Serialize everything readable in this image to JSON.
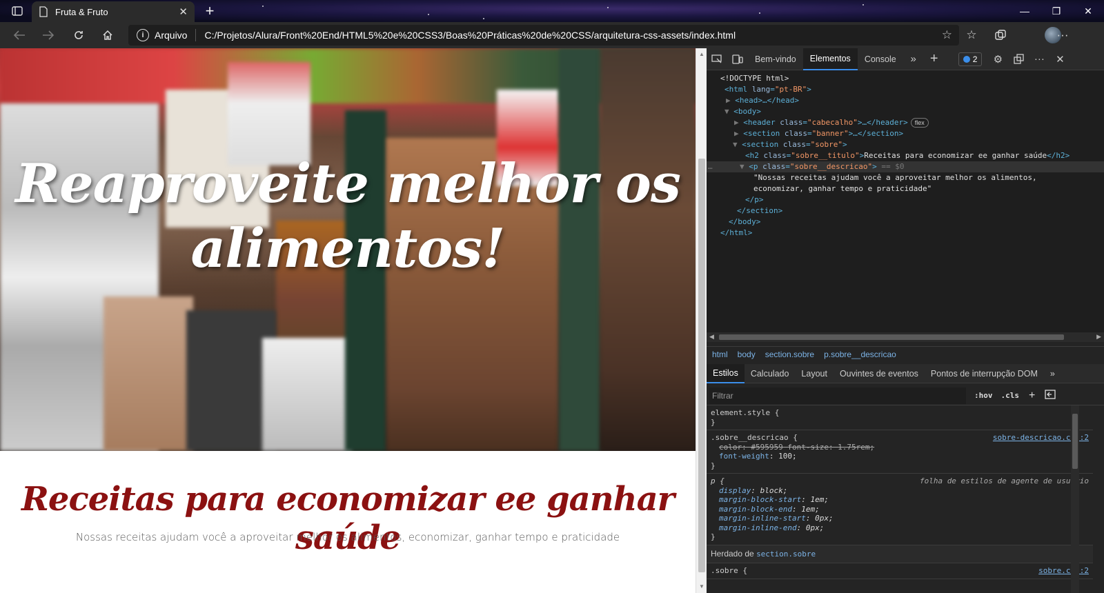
{
  "browser": {
    "tab_title": "Fruta & Fruto",
    "tab_close": "✕",
    "new_tab": "+",
    "site_info": "i",
    "protocol_label": "Arquivo",
    "url": "C:/Projetos/Alura/Front%20End/HTML5%20e%20CSS3/Boas%20Práticas%20de%20CSS/arquitetura-css-assets/index.html",
    "window_controls": [
      "—",
      "❐",
      "✕"
    ],
    "nav_icons": [
      "back-icon",
      "forward-icon",
      "refresh-icon",
      "home-icon"
    ],
    "toolbar_icons": [
      "favorite-add-icon",
      "favorites-icon",
      "collections-icon",
      "profile-icon",
      "more-icon"
    ]
  },
  "page": {
    "banner_title": "Reaproveite melhor os alimentos!",
    "sobre_titulo": "Receitas para economizar ee ganhar saúde",
    "sobre_descricao": "Nossas receitas ajudam você a aproveitar melhor os alimentos, economizar, ganhar tempo e praticidade",
    "title_color": "#8b1111",
    "desc_color": "#595959"
  },
  "devtools": {
    "tabs": [
      {
        "label": "Bem-vindo",
        "active": false
      },
      {
        "label": "Elementos",
        "active": true
      },
      {
        "label": "Console",
        "active": false
      }
    ],
    "issues_count": "2",
    "dom_lines": {
      "doctype": "<!DOCTYPE html>",
      "html_open_tag": "<html",
      "html_attr": "lang",
      "html_val": "\"pt-BR\"",
      "head": "<head>…</head>",
      "body_open": "<body>",
      "header_tag": "<header",
      "header_attr": "class",
      "header_val": "\"cabecalho\"",
      "header_rest": ">…</header>",
      "flex_badge": "flex",
      "section_banner_tag": "<section",
      "section_banner_attr": "class",
      "section_banner_val": "\"banner\"",
      "section_banner_rest": ">…</section>",
      "section_sobre_tag": "<section",
      "section_sobre_attr": "class",
      "section_sobre_val": "\"sobre\"",
      "h2_tag": "<h2",
      "h2_attr": "class",
      "h2_val": "\"sobre__titulo\"",
      "h2_text": "Receitas para economizar ee ganhar saúde",
      "h2_close": "</h2>",
      "p_tag": "<p",
      "p_attr": "class",
      "p_val": "\"sobre__descricao\"",
      "p_eq": "== $0",
      "p_text_1": "\"Nossas receitas ajudam você a aproveitar melhor os alimentos,",
      "p_text_2": "economizar, ganhar tempo e praticidade\"",
      "p_close": "</p>",
      "section_close": "</section>",
      "body_close": "</body>",
      "html_close": "</html>",
      "gutter_dots": "…"
    },
    "breadcrumbs": [
      "html",
      "body",
      "section.sobre",
      "p.sobre__descricao"
    ],
    "sub_tabs": [
      {
        "label": "Estilos",
        "active": true
      },
      {
        "label": "Calculado",
        "active": false
      },
      {
        "label": "Layout",
        "active": false
      },
      {
        "label": "Ouvintes de eventos",
        "active": false
      },
      {
        "label": "Pontos de interrupção DOM",
        "active": false
      }
    ],
    "filter_placeholder": "Filtrar",
    "hov_btn": ":hov",
    "cls_btn": ".cls",
    "styles": {
      "element_style": "element.style {",
      "close_brace": "}",
      "rule1_selector": ".sobre__descricao {",
      "rule1_source": "sobre-descricao.css:2",
      "rule1_strike": "color: #595959 font-size: 1.75rem;",
      "rule1_prop": "font-weight",
      "rule1_val": "100;",
      "ua_selector": "p {",
      "ua_source": "folha de estilos de agente de usuário",
      "ua_props": [
        {
          "n": "display",
          "v": "block;"
        },
        {
          "n": "margin-block-start",
          "v": "1em;"
        },
        {
          "n": "margin-block-end",
          "v": "1em;"
        },
        {
          "n": "margin-inline-start",
          "v": "0px;"
        },
        {
          "n": "margin-inline-end",
          "v": "0px;"
        }
      ],
      "inherited_label": "Herdado de",
      "inherited_from": "section.sobre",
      "rule2_selector": ".sobre {",
      "rule2_source": "sobre.css:2"
    }
  }
}
